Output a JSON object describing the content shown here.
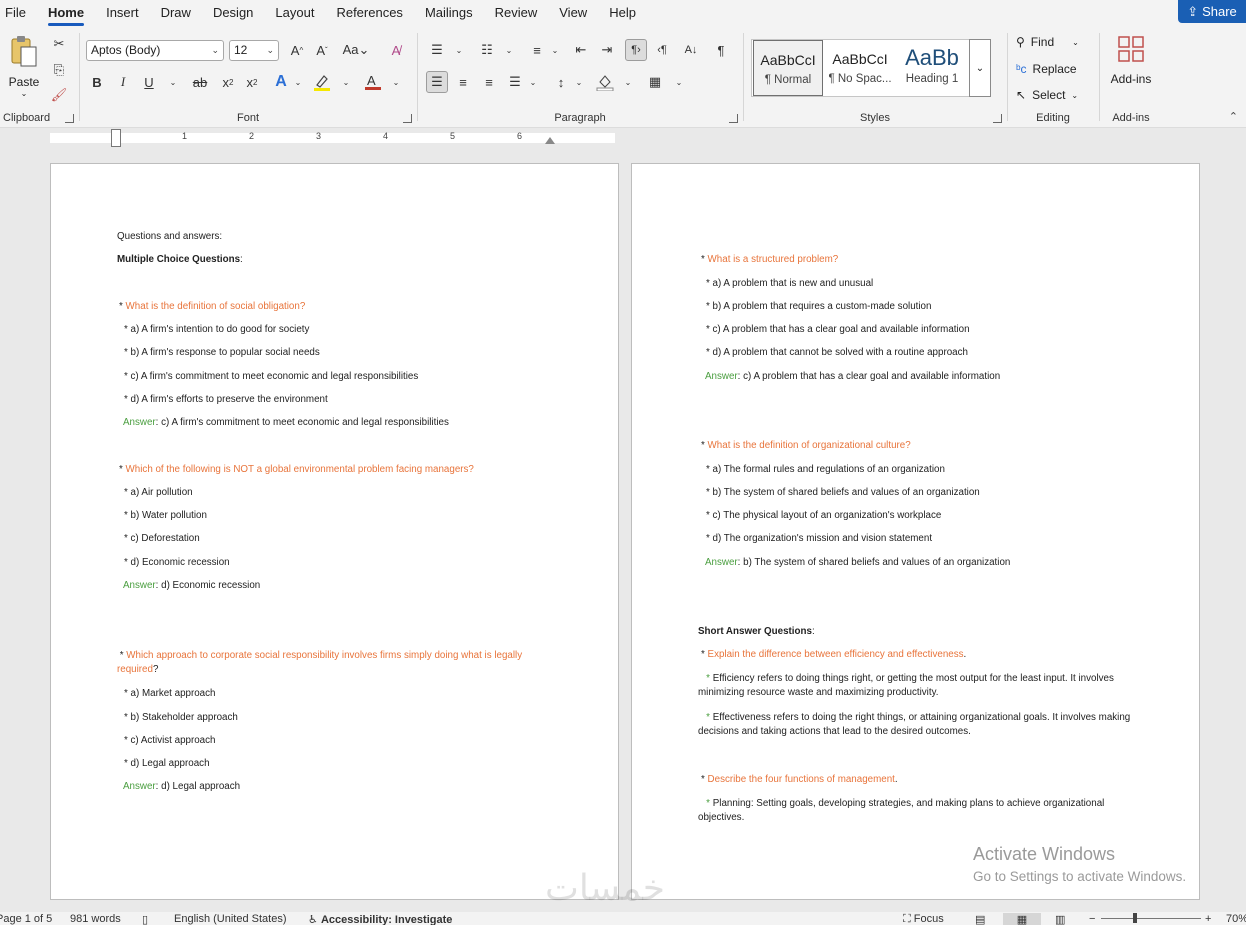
{
  "menu": {
    "items": [
      "File",
      "Home",
      "Insert",
      "Draw",
      "Design",
      "Layout",
      "References",
      "Mailings",
      "Review",
      "View",
      "Help"
    ],
    "active": "Home",
    "share_label": "Share"
  },
  "ribbon": {
    "clipboard": {
      "label": "Clipboard",
      "paste_label": "Paste"
    },
    "font": {
      "label": "Font",
      "font_name": "Aptos (Body)",
      "font_size": "12"
    },
    "paragraph": {
      "label": "Paragraph"
    },
    "styles": {
      "label": "Styles",
      "items": [
        {
          "sample": "AaBbCcI",
          "name": "¶ Normal"
        },
        {
          "sample": "AaBbCcI",
          "name": "¶ No Spac..."
        },
        {
          "sample": "AaBb",
          "name": "Heading 1"
        }
      ]
    },
    "editing": {
      "label": "Editing",
      "find": "Find",
      "replace": "Replace",
      "select": "Select"
    },
    "addins": {
      "label": "Add-ins",
      "button": "Add-ins"
    }
  },
  "ruler": {
    "numbers": [
      "1",
      "2",
      "3",
      "4",
      "5",
      "6"
    ]
  },
  "page1": {
    "intro": "Questions and answers:",
    "mcq_heading": "Multiple Choice Questions",
    "q1": "What is the definition of social obligation?",
    "q1_options": [
      "* a) A firm's intention to do good for society",
      "* b) A firm's response to popular social needs",
      "* c) A firm's commitment to meet economic and legal responsibilities",
      "* d) A firm's efforts to preserve the environment"
    ],
    "q1_answer": "c) A firm's commitment to meet economic and legal responsibilities",
    "q2": "Which of the following is NOT a global environmental problem facing managers?",
    "q2_options": [
      "* a) Air pollution",
      "* b) Water pollution",
      "* c) Deforestation",
      "* d) Economic recession"
    ],
    "q2_answer": "d) Economic recession",
    "q3": "Which approach to corporate social responsibility involves firms simply doing what is legally required",
    "q3_options": [
      "* a) Market approach",
      "* b) Stakeholder approach",
      "* c) Activist approach",
      "* d) Legal approach"
    ],
    "q3_answer": "d) Legal approach",
    "answer_label": "Answer"
  },
  "page2": {
    "q4": "What is a structured problem?",
    "q4_options": [
      "* a) A problem that is new and unusual",
      "* b) A problem that requires a custom-made solution",
      "* c) A problem that has a clear goal and available information",
      "* d) A problem that cannot be solved with a routine approach"
    ],
    "q4_answer": "c) A problem that has a clear goal and available information",
    "q5": "What is the definition of organizational culture?",
    "q5_options": [
      "* a) The formal rules and regulations of an organization",
      "* b) The system of shared beliefs and values of an organization",
      "* c) The physical layout of an organization's workplace",
      "* d) The organization's mission and vision statement"
    ],
    "q5_answer": "b) The system of shared beliefs and values of an organization",
    "saq_heading": "Short Answer Questions",
    "q6": "Explain the difference between efficiency and effectiveness",
    "q6_p1": "Efficiency refers to doing things right, or getting the most output for the least input. It involves minimizing resource waste and maximizing productivity.",
    "q6_p2": "Effectiveness refers to doing the right things, or attaining organizational goals. It involves making decisions and taking actions that lead to the desired outcomes.",
    "q7": "Describe the four functions of management",
    "q7_p1": "Planning: Setting goals, developing strategies, and making plans to achieve organizational objectives."
  },
  "watermark": {
    "title": "Activate Windows",
    "subtitle": "Go to Settings to activate Windows.",
    "arabic": "خمسات"
  },
  "status": {
    "page": "Page 1 of 5",
    "words": "981 words",
    "language": "English (United States)",
    "accessibility": "Accessibility: Investigate",
    "focus": "Focus",
    "zoom": "70%"
  }
}
